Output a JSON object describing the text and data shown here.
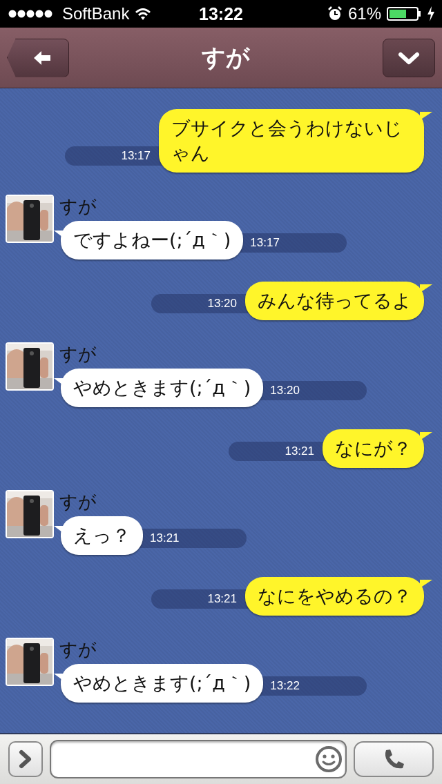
{
  "status_bar": {
    "carrier": "SoftBank",
    "time": "13:22",
    "battery_percent": "61%"
  },
  "header": {
    "title": "すが"
  },
  "messages": [
    {
      "kind": "sent",
      "text": "ブサイクと会うわけないじゃん",
      "time": "13:17"
    },
    {
      "kind": "received",
      "sender": "すが",
      "text": "ですよねー(;´д｀)",
      "time": "13:17"
    },
    {
      "kind": "sent",
      "text": "みんな待ってるよ",
      "time": "13:20"
    },
    {
      "kind": "received",
      "sender": "すが",
      "text": "やめときます(;´д｀)",
      "time": "13:20"
    },
    {
      "kind": "sent",
      "text": "なにが？",
      "time": "13:21"
    },
    {
      "kind": "received",
      "sender": "すが",
      "text": "えっ？",
      "time": "13:21"
    },
    {
      "kind": "sent",
      "text": "なにをやめるの？",
      "time": "13:21"
    },
    {
      "kind": "received",
      "sender": "すが",
      "text": "やめときます(;´д｀)",
      "time": "13:22"
    }
  ]
}
